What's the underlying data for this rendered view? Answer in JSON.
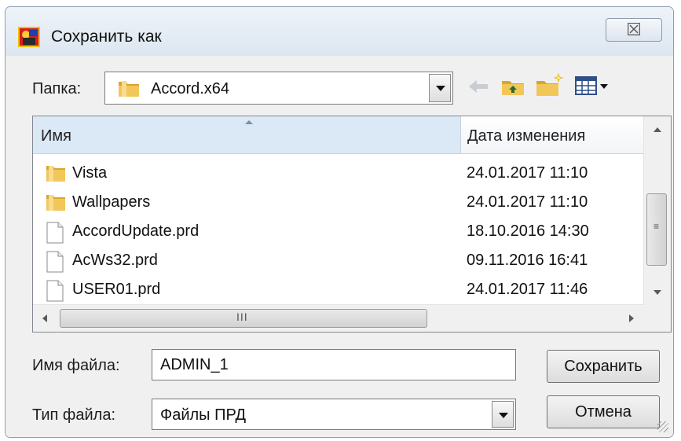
{
  "window": {
    "title": "Сохранить как",
    "close_glyph": "☒",
    "icons": {
      "app": "app-icon",
      "close": "close-icon"
    }
  },
  "folder": {
    "label": "Папка:",
    "value": "Accord.x64",
    "toolbar_icons": [
      "back-arrow-icon",
      "up-folder-icon",
      "new-folder-icon",
      "view-menu-icon"
    ]
  },
  "list": {
    "columns": {
      "name": "Имя",
      "date": "Дата изменения"
    },
    "rows": [
      {
        "name": "Vista",
        "date": "24.01.2017 11:10",
        "icon": "folder-icon"
      },
      {
        "name": "Wallpapers",
        "date": "24.01.2017 11:10",
        "icon": "folder-icon"
      },
      {
        "name": "AccordUpdate.prd",
        "date": "18.10.2016 14:30",
        "icon": "file-icon"
      },
      {
        "name": "AcWs32.prd",
        "date": "09.11.2016 16:41",
        "icon": "file-icon"
      },
      {
        "name": "USER01.prd",
        "date": "24.01.2017 11:46",
        "icon": "file-icon"
      }
    ],
    "scroll_grip_glyph": "III"
  },
  "filename": {
    "label": "Имя файла:",
    "value": "ADMIN_1"
  },
  "filetype": {
    "label": "Тип файла:",
    "value": "Файлы ПРД"
  },
  "buttons": {
    "save": "Сохранить",
    "cancel": "Отмена"
  },
  "colors": {
    "header_highlight": "#dbe8f5",
    "folder_yellow": "#e8b83c"
  }
}
